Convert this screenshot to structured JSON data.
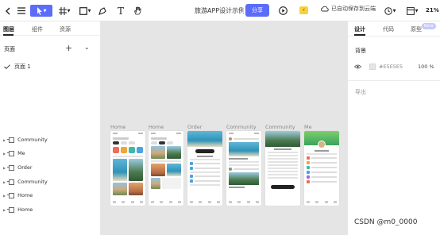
{
  "toolbar": {
    "doc_title": "旅游APP设计示例",
    "share_label": "分享",
    "save_status": "已自动保存到云端",
    "zoom": "21%"
  },
  "left_panel": {
    "tabs": [
      "图层",
      "组件",
      "资源"
    ],
    "pages_header": "页面",
    "add_icon": "+",
    "collapse_icon": "⌄",
    "page_item": "页面 1",
    "layers": [
      "Community",
      "Me",
      "Order",
      "Community",
      "Home",
      "Home"
    ]
  },
  "canvas": {
    "frame_labels": [
      "Home",
      "Home",
      "Order",
      "Community",
      "Community",
      "Me"
    ],
    "background_color": "#E5E5E5"
  },
  "right_panel": {
    "tabs": [
      "设计",
      "代码",
      "原型"
    ],
    "beta_badge": "Beta",
    "background_label": "背景",
    "hex": "#E5E5E5",
    "opacity": "100 %",
    "export_label": "导出"
  },
  "watermark": "CSDN @m0_0000"
}
